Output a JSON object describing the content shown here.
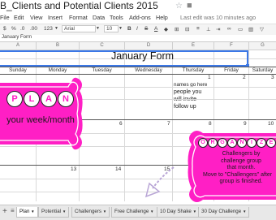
{
  "window": {
    "doc_title": "B_Clients and Potential Clients 2015",
    "star_icon": "star-icon",
    "folder_icon": "folder-icon"
  },
  "menu": {
    "items": [
      "File",
      "Edit",
      "View",
      "Insert",
      "Format",
      "Data",
      "Tools",
      "Add-ons",
      "Help"
    ],
    "last_edit": "Last edit was 10 minutes ago"
  },
  "toolbar": {
    "percent": "%",
    "decimal_less": ".0",
    "decimal_more": ".00",
    "number_format": "123",
    "font": "Arial",
    "font_size": "10"
  },
  "formula_bar": {
    "value": "January Form"
  },
  "sheet": {
    "columns": [
      "A",
      "B",
      "C",
      "D",
      "E",
      "F",
      "G"
    ],
    "form_title": "January Form",
    "days": [
      "Sunday",
      "Monday",
      "Tuesday",
      "Wednesday",
      "Thursday",
      "Friday",
      "Saturday"
    ],
    "row1_numbers": [
      "1",
      "2",
      "3"
    ],
    "row2_numbers": [
      "6",
      "7",
      "8",
      "9",
      "10"
    ],
    "row3_numbers": [
      "13",
      "14",
      "15",
      "16",
      "17"
    ],
    "note_line1": "names go here",
    "note_line2": "people you",
    "note_line3": "will invite",
    "note_line4": "follow up"
  },
  "plan_badge": {
    "letters": [
      "P",
      "L",
      "A",
      "N"
    ],
    "subtitle": "your week/month",
    "color": "#ff1fc5"
  },
  "organize_badge": {
    "letters": [
      "O",
      "R",
      "G",
      "A",
      "N",
      "I",
      "Z",
      "E"
    ],
    "line1": "Challengers by",
    "line2": "challenge group",
    "line3": "that month.",
    "line4": "Move to \"Challengers\" after",
    "line5": "group is finished.",
    "color": "#ff1fc5"
  },
  "tabs": {
    "add_sheet_icon": "plus-icon",
    "sheet_list_icon": "list-icon",
    "items": [
      "Plan",
      "Potential",
      "Challengers",
      "Free Challenge",
      "10 Day Shake",
      "30 Day Challenge"
    ]
  }
}
